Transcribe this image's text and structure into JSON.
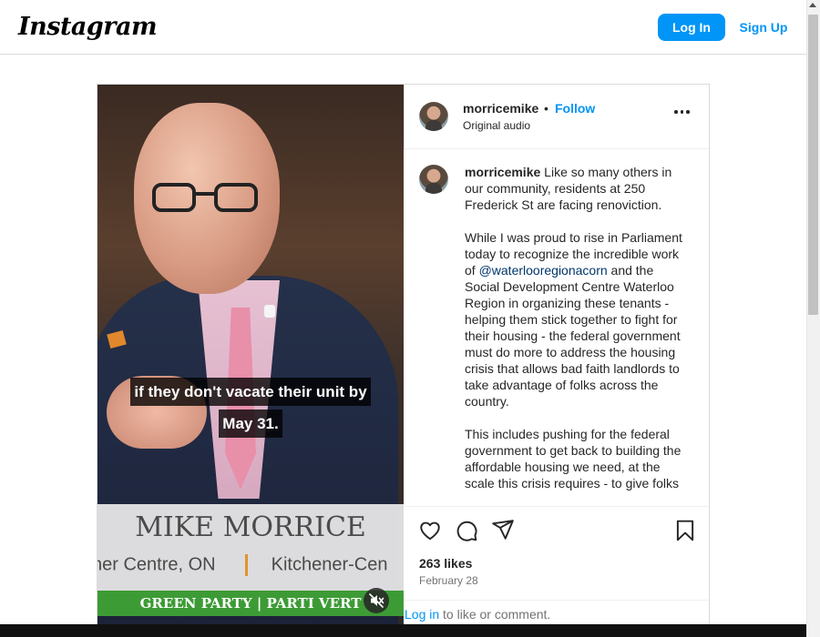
{
  "header": {
    "logo_text": "Instagram",
    "login_label": "Log In",
    "signup_label": "Sign Up"
  },
  "video": {
    "caption_line1": "if they don't vacate their unit by",
    "caption_line2": "May 31.",
    "lower_third_name": "MIKE MORRICE",
    "lower_third_riding_left": "ner Centre, ON",
    "lower_third_riding_right": "Kitchener-Cen",
    "party_banner": "GREEN PARTY | PARTI VERT",
    "mute_icon": "speaker-muted-icon"
  },
  "post_header": {
    "username": "morricemike",
    "separator": "•",
    "follow_label": "Follow",
    "audio_label": "Original audio",
    "more_icon": "more-options-icon"
  },
  "caption": {
    "username": "morricemike",
    "text_part1": " Like so many others in our community, residents at 250 Frederick St are facing renoviction.\n\nWhile I was proud to rise in Parliament today to recognize the incredible work of ",
    "mention": "@waterlooregionacorn",
    "text_part2": " and the Social Development Centre Waterloo Region in organizing these tenants - helping them stick together to fight for their housing - the federal government must do more to address the housing crisis that allows bad faith landlords to take advantage of folks across the country.\n\nThis includes pushing for the federal government to get back to building the affordable housing we need, at the scale this crisis requires - to give folks"
  },
  "actions": {
    "like_icon": "heart-icon",
    "comment_icon": "comment-icon",
    "share_icon": "share-icon",
    "save_icon": "bookmark-icon",
    "likes_text": "263 likes",
    "date_text": "February 28"
  },
  "login_prompt": {
    "link": "Log in",
    "rest": " to like or comment."
  }
}
